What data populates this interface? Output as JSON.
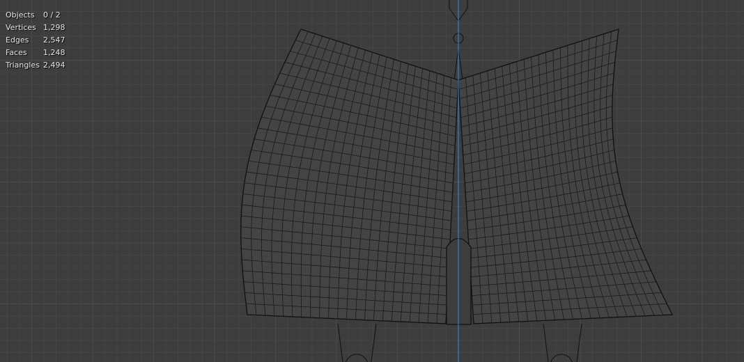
{
  "stats": [
    {
      "label": "Objects",
      "value": "0 / 2"
    },
    {
      "label": "Vertices",
      "value": "1,298"
    },
    {
      "label": "Edges",
      "value": "2,547"
    },
    {
      "label": "Faces",
      "value": "1,248"
    },
    {
      "label": "Triangles",
      "value": "2,494"
    }
  ],
  "colors": {
    "background": "#3d3d3d",
    "mesh_fill": "#444444",
    "wire": "#111111",
    "axis": "#3a7bd5"
  }
}
